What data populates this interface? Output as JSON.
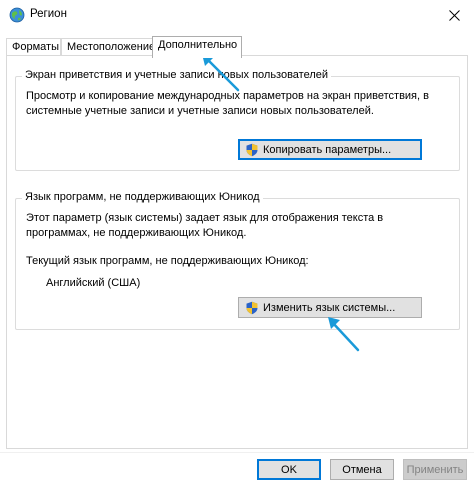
{
  "window": {
    "title": "Регион",
    "close_glyph": "✕"
  },
  "tabs": [
    {
      "label": "Форматы",
      "active": false
    },
    {
      "label": "Местоположение",
      "active": false
    },
    {
      "label": "Дополнительно",
      "active": true
    }
  ],
  "welcome_group": {
    "title": "Экран приветствия и учетные записи новых пользователей",
    "text_line1": "Просмотр и копирование международных параметров на экран приветствия, в",
    "text_line2": "системные учетные записи и учетные записи новых пользователей.",
    "button_label": "Копировать параметры..."
  },
  "nonunicode_group": {
    "title": "Язык программ, не поддерживающих Юникод",
    "text_line1": "Этот параметр (язык системы) задает язык для отображения текста в",
    "text_line2": "программах, не поддерживающих Юникод.",
    "current_label": "Текущий язык программ, не поддерживающих Юникод:",
    "current_value": "Английский (США)",
    "button_label": "Изменить язык системы..."
  },
  "footer": {
    "ok_label": "OK",
    "cancel_label": "Отмена",
    "apply_label": "Применить"
  },
  "colors": {
    "accent": "#0078d7",
    "annotation_arrow": "#1a9ad9",
    "button_face": "#e1e1e1"
  },
  "icons": {
    "app": "globe-icon",
    "close": "close-icon",
    "uac": "uac-shield-icon"
  }
}
